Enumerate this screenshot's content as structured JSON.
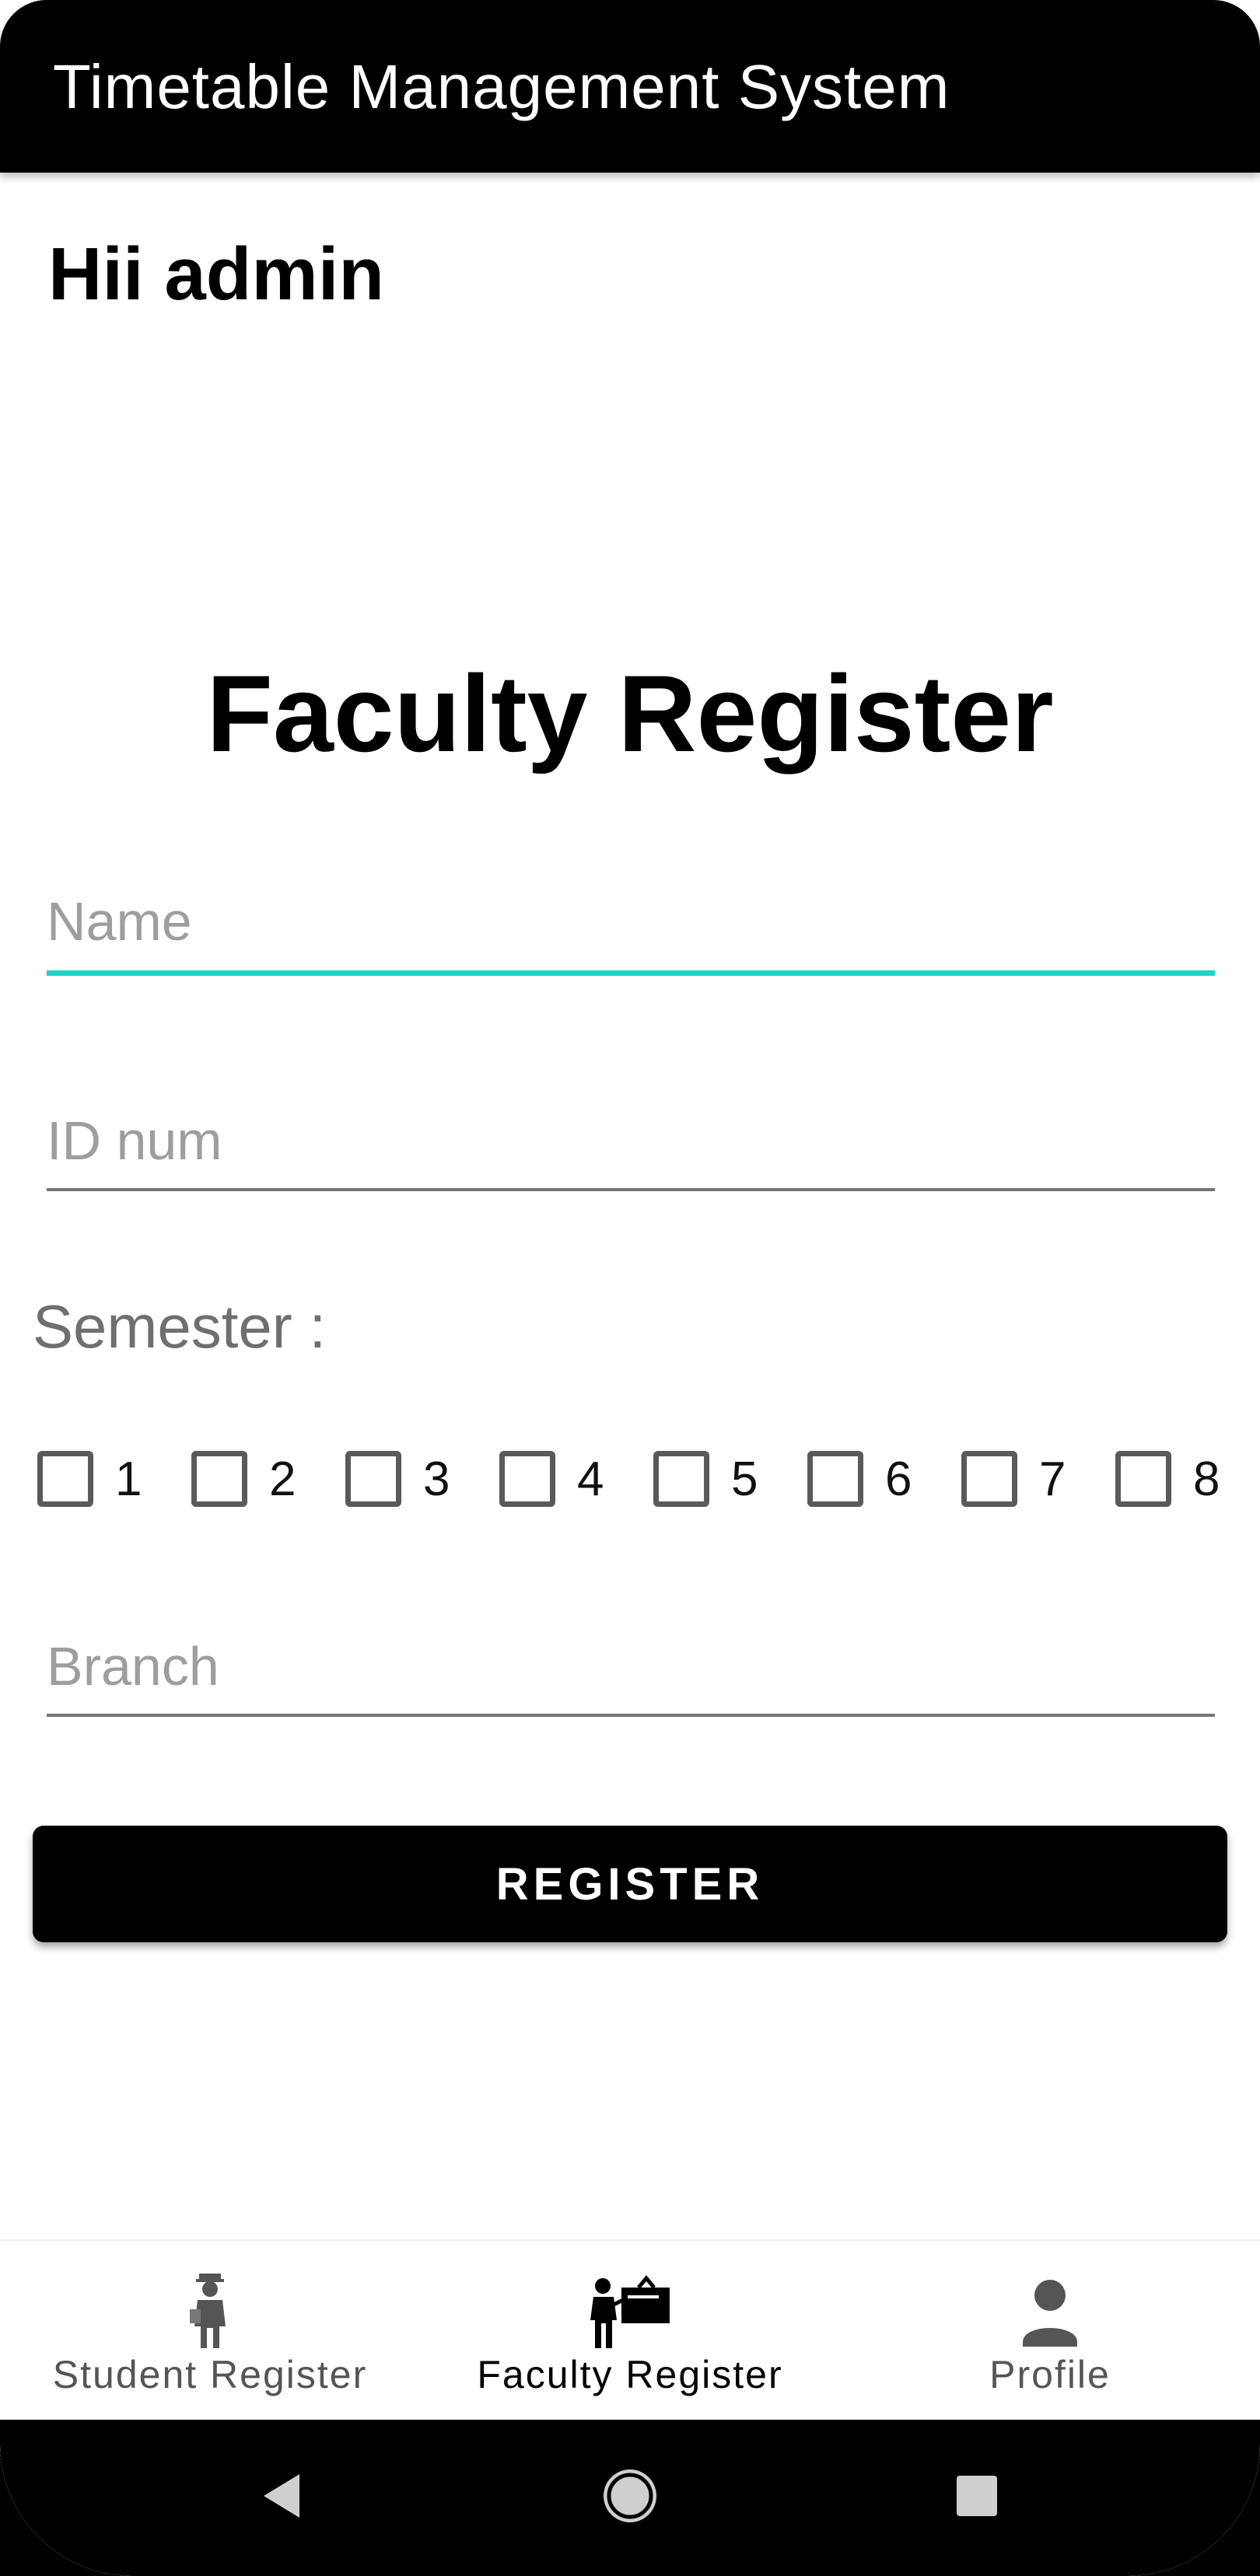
{
  "app_bar": {
    "title": "Timetable Management System"
  },
  "greeting": "Hii admin",
  "form": {
    "title": "Faculty Register",
    "name_placeholder": "Name",
    "name_value": "",
    "id_placeholder": "ID num",
    "id_value": "",
    "semester_label": "Semester :",
    "semesters": [
      "1",
      "2",
      "3",
      "4",
      "5",
      "6",
      "7",
      "8"
    ],
    "branch_placeholder": "Branch",
    "branch_value": "",
    "register_label": "REGISTER"
  },
  "bottom_nav": {
    "items": [
      {
        "label": "Student Register",
        "icon": "student-icon",
        "active": false
      },
      {
        "label": "Faculty Register",
        "icon": "teacher-icon",
        "active": true
      },
      {
        "label": "Profile",
        "icon": "person-icon",
        "active": false
      }
    ]
  },
  "colors": {
    "accent": "#1fd3c6",
    "app_bar": "#000000",
    "button": "#000000"
  }
}
